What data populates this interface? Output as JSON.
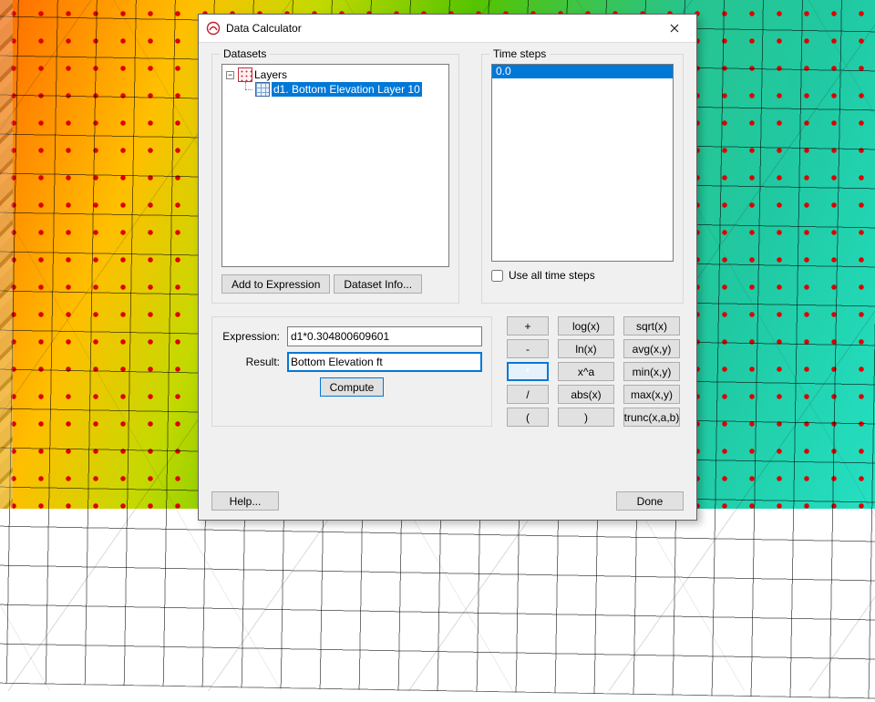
{
  "dialog": {
    "title": "Data Calculator"
  },
  "datasets_group": {
    "legend": "Datasets",
    "root_label": "Layers",
    "child_label": "d1. Bottom Elevation Layer 10",
    "add_expr_btn": "Add to Expression",
    "dataset_info_btn": "Dataset Info..."
  },
  "timesteps_group": {
    "legend": "Time steps",
    "items": [
      "0.0"
    ],
    "use_all_label": "Use all time steps"
  },
  "expression": {
    "expr_label": "Expression:",
    "expr_value": "d1*0.304800609601",
    "result_label": "Result:",
    "result_value": "Bottom Elevation ft",
    "compute_btn": "Compute"
  },
  "ops": {
    "add": "+",
    "log": "log(x)",
    "sqrt": "sqrt(x)",
    "sub": "-",
    "ln": "ln(x)",
    "avg": "avg(x,y)",
    "mul": "*",
    "pow": "x^a",
    "min": "min(x,y)",
    "div": "/",
    "abs": "abs(x)",
    "max": "max(x,y)",
    "lpar": "(",
    "rpar": ")",
    "trunc": "trunc(x,a,b)"
  },
  "footer": {
    "help_btn": "Help...",
    "done_btn": "Done"
  }
}
